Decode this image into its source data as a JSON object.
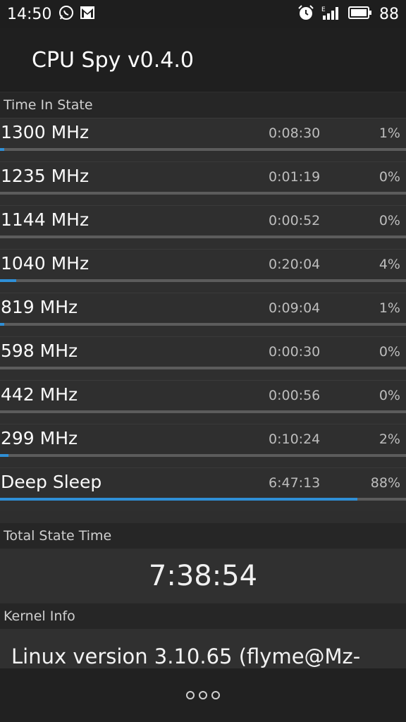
{
  "status_bar": {
    "time": "14:50",
    "left_icons": [
      "whatsapp-icon",
      "gmail-icon"
    ],
    "right_icons": [
      "alarm-icon",
      "signal-e-icon",
      "battery-icon"
    ],
    "battery_percent": "88"
  },
  "app": {
    "title": "CPU Spy v0.4.0"
  },
  "sections": {
    "time_in_state": "Time In State",
    "total_state_time": "Total State Time",
    "kernel_info": "Kernel Info"
  },
  "states": [
    {
      "frequency": "1300 MHz",
      "duration": "0:08:30",
      "percent": "1%",
      "fraction": 0.01
    },
    {
      "frequency": "1235 MHz",
      "duration": "0:01:19",
      "percent": "0%",
      "fraction": 0.0
    },
    {
      "frequency": "1144 MHz",
      "duration": "0:00:52",
      "percent": "0%",
      "fraction": 0.0
    },
    {
      "frequency": "1040 MHz",
      "duration": "0:20:04",
      "percent": "4%",
      "fraction": 0.04
    },
    {
      "frequency": "819 MHz",
      "duration": "0:09:04",
      "percent": "1%",
      "fraction": 0.01
    },
    {
      "frequency": "598 MHz",
      "duration": "0:00:30",
      "percent": "0%",
      "fraction": 0.0
    },
    {
      "frequency": "442 MHz",
      "duration": "0:00:56",
      "percent": "0%",
      "fraction": 0.0
    },
    {
      "frequency": "299 MHz",
      "duration": "0:10:24",
      "percent": "2%",
      "fraction": 0.02
    },
    {
      "frequency": "Deep Sleep",
      "duration": "6:47:13",
      "percent": "88%",
      "fraction": 0.88
    }
  ],
  "total_state_time": "7:38:54",
  "kernel_info": "Linux version 3.10.65 (flyme@Mz-",
  "bottom_bar": {
    "menu_icon": "overflow-menu-icon"
  },
  "colors": {
    "accent": "#2f8fd6",
    "track": "#5c5c5c"
  }
}
